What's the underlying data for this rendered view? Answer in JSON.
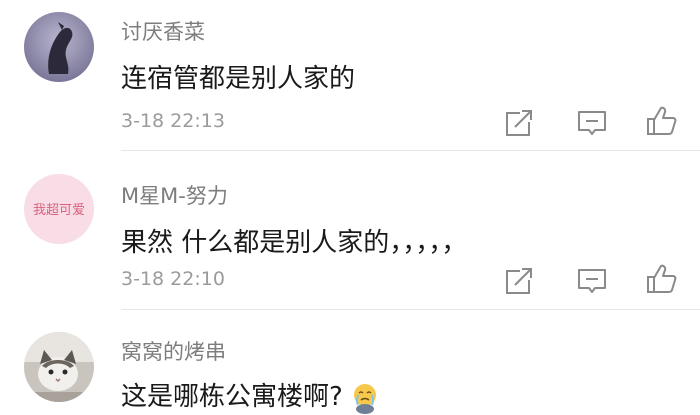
{
  "comments": [
    {
      "username": "讨厌香菜",
      "content": "连宿管都是别人家的",
      "timestamp": "3-18 22:13"
    },
    {
      "username": "M星M-努力",
      "avatar_text": "我超可爱",
      "content": "果然  什么都是别人家的，，，，，",
      "timestamp": "3-18 22:10"
    },
    {
      "username": "窝窝的烤串",
      "content": "这是哪栋公寓楼啊?"
    }
  ],
  "icons": [
    "share-icon",
    "comment-icon",
    "like-icon"
  ],
  "colors": {
    "username": "#7d7d7d",
    "content": "#1a1a1a",
    "timestamp": "#9b9b9b",
    "avatar2_bg": "#f8dde6",
    "avatar2_text": "#d9627d"
  }
}
